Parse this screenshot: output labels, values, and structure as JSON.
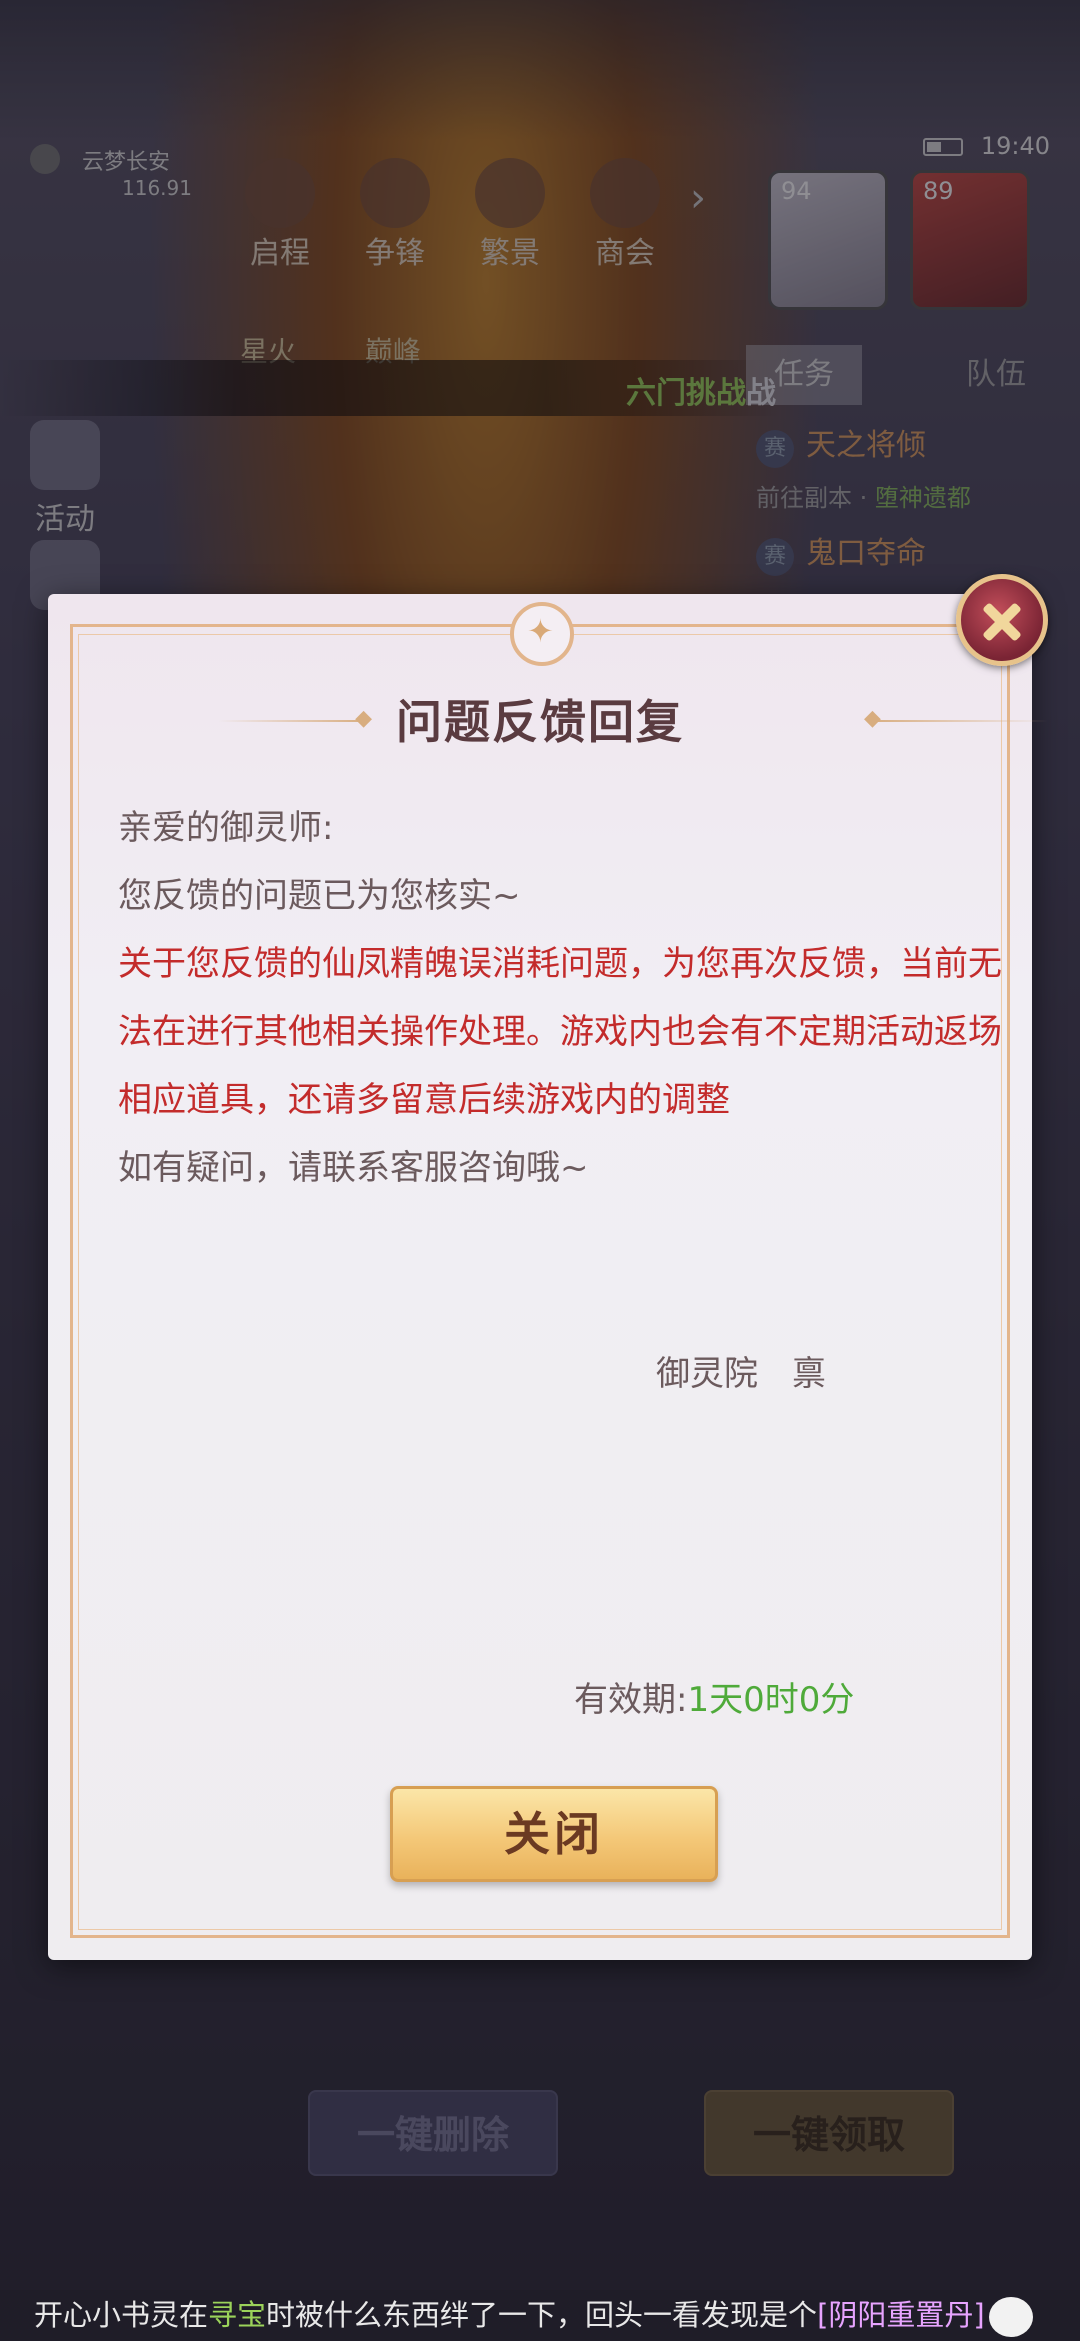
{
  "hud": {
    "server_name": "云梦长安",
    "server_num": "116.91",
    "time": "19:40",
    "nav": [
      "启程",
      "争锋",
      "繁景",
      "商会"
    ],
    "row2": [
      "星火",
      "巅峰"
    ],
    "avatars": [
      {
        "level": "94"
      },
      {
        "level": "89"
      }
    ],
    "ticker_green": "六门挑战",
    "ticker_end": "战",
    "tabs": {
      "task": "任务",
      "team": "队伍"
    },
    "tasks": [
      {
        "badge": "赛",
        "title": "天之将倾",
        "desc_prefix": "前往副本 · ",
        "desc_link": "堕神遗都"
      },
      {
        "badge": "赛",
        "title": "鬼口夺命",
        "desc_prefix": "",
        "desc_link": ""
      }
    ],
    "left_icons": [
      "活动"
    ],
    "bottom": {
      "delete_all": "一键删除",
      "claim_all": "一键领取"
    }
  },
  "dialog": {
    "title": "问题反馈回复",
    "greeting": "亲爱的御灵师:",
    "line1": "您反馈的问题已为您核实~",
    "red_text": "关于您反馈的仙凤精魄误消耗问题，为您再次反馈，当前无法在进行其他相关操作处理。游戏内也会有不定期活动返场相应道具，还请多留意后续游戏内的调整",
    "line2": "如有疑问，请联系客服咨询哦~",
    "signature": "御灵院　禀",
    "expiry_label": "有效期:",
    "expiry_value": "1天0时0分",
    "close_label": "关闭"
  },
  "chat": {
    "name": "开心小书灵",
    "t1": "在",
    "loc": "寻宝",
    "t2": "时被什么东西绊了一下，回头一看发现是个",
    "item": "[阴阳重置丹]"
  },
  "colors": {
    "red_text": "#c32b2b",
    "expiry_green": "#4faa3a",
    "ticker_green": "#9bd35a"
  }
}
